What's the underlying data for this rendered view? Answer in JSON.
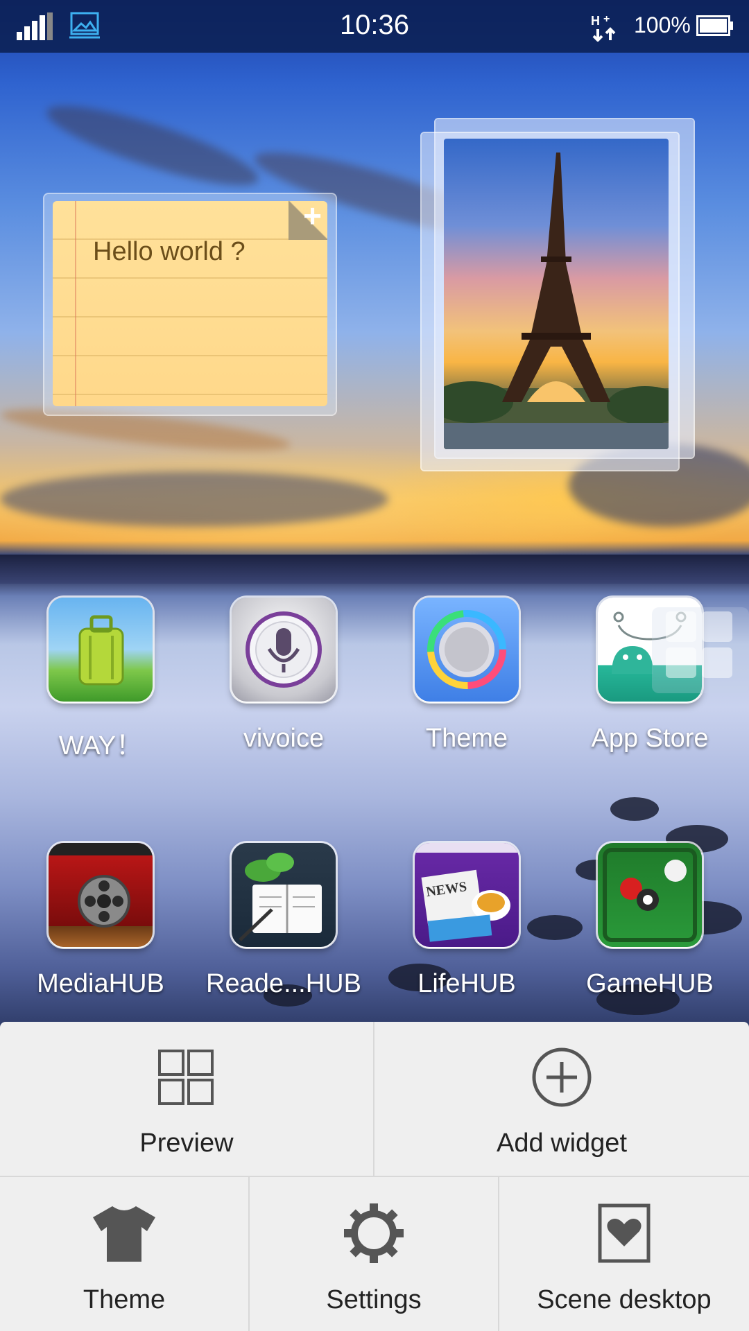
{
  "status_bar": {
    "time": "10:36",
    "battery_percent": "100%",
    "icons": [
      "signal-icon",
      "screenshot-icon",
      "data-transfer-icon",
      "battery-icon"
    ]
  },
  "widgets": {
    "note": {
      "text": "Hello world ?",
      "icon": "add-icon"
    },
    "photo": {
      "subject": "eiffel-tower-photo"
    }
  },
  "apps": [
    {
      "label": "WAY！",
      "icon": "luggage-icon"
    },
    {
      "label": "vivoice",
      "icon": "microphone-icon"
    },
    {
      "label": "Theme",
      "icon": "theme-dial-icon"
    },
    {
      "label": "App Store",
      "icon": "app-store-icon"
    },
    {
      "label": "MediaHUB",
      "icon": "film-reel-icon"
    },
    {
      "label": "Reade...HUB",
      "icon": "book-icon"
    },
    {
      "label": "LifeHUB",
      "icon": "news-icon"
    },
    {
      "label": "GameHUB",
      "icon": "billiards-icon"
    }
  ],
  "bottom_menu": {
    "top_row": [
      {
        "label": "Preview",
        "icon": "grid-icon"
      },
      {
        "label": "Add widget",
        "icon": "add-circle-icon"
      }
    ],
    "bottom_row": [
      {
        "label": "Theme",
        "icon": "tshirt-icon"
      },
      {
        "label": "Settings",
        "icon": "gear-icon"
      },
      {
        "label": "Scene desktop",
        "icon": "heart-frame-icon"
      }
    ]
  }
}
